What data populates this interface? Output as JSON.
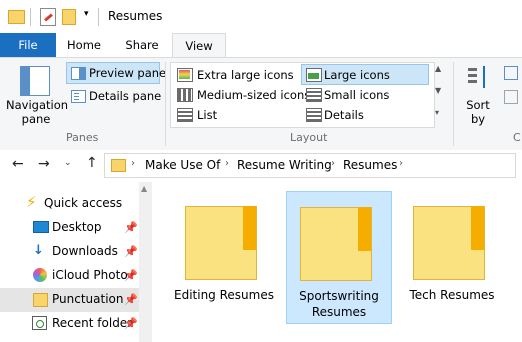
{
  "window": {
    "title": "Resumes"
  },
  "tabs": [
    {
      "label": "File"
    },
    {
      "label": "Home"
    },
    {
      "label": "Share"
    },
    {
      "label": "View"
    }
  ],
  "ribbon": {
    "panes": {
      "navigation_pane": "Navigation\npane",
      "preview_pane": "Preview pane",
      "details_pane": "Details pane",
      "group_label": "Panes"
    },
    "layout": {
      "items": [
        "Extra large icons",
        "Large icons",
        "Medium-sized icons",
        "Small icons",
        "List",
        "Details"
      ],
      "selected": "Large icons",
      "group_label": "Layout"
    },
    "sort": {
      "label": "Sort\nby"
    },
    "partial_group_label": "C"
  },
  "address": {
    "crumbs": [
      "Make Use Of",
      "Resume Writing",
      "Resumes"
    ]
  },
  "nav": {
    "items": [
      {
        "label": "Quick access",
        "icon": "star-icon"
      },
      {
        "label": "Desktop",
        "icon": "desktop-icon",
        "pinned": true
      },
      {
        "label": "Downloads",
        "icon": "download-icon",
        "pinned": true
      },
      {
        "label": "iCloud Photo",
        "icon": "icloud-photos-icon",
        "pinned": true
      },
      {
        "label": "Punctuation",
        "icon": "folder-icon",
        "pinned": true
      },
      {
        "label": "Recent folder",
        "icon": "recent-folder-icon",
        "pinned": true
      }
    ]
  },
  "files": [
    {
      "name": "Editing Resumes",
      "selected": false
    },
    {
      "name": "Sportswriting Resumes",
      "selected": true
    },
    {
      "name": "Tech Resumes",
      "selected": false
    }
  ]
}
